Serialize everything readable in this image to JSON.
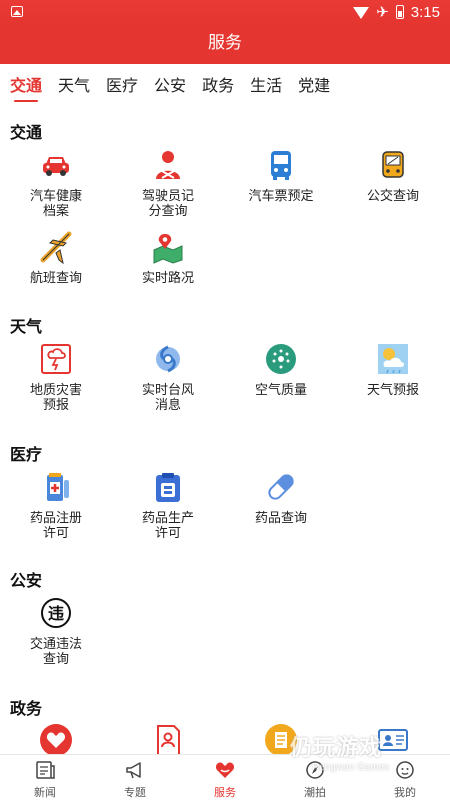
{
  "status": {
    "time": "3:15"
  },
  "header": {
    "title": "服务"
  },
  "tabs": [
    {
      "label": "交通"
    },
    {
      "label": "天气"
    },
    {
      "label": "医疗"
    },
    {
      "label": "公安"
    },
    {
      "label": "政务"
    },
    {
      "label": "生活"
    },
    {
      "label": "党建"
    }
  ],
  "sections": {
    "traffic": {
      "title": "交通",
      "items": [
        {
          "label": "汽车健康\n档案",
          "icon": "car-icon"
        },
        {
          "label": "驾驶员记\n分查询",
          "icon": "driver-icon"
        },
        {
          "label": "汽车票预定",
          "icon": "bus-icon"
        },
        {
          "label": "公交查询",
          "icon": "bus-card-icon"
        },
        {
          "label": "航班查询",
          "icon": "airplane-icon"
        },
        {
          "label": "实时路况",
          "icon": "map-pin-icon"
        }
      ]
    },
    "weather": {
      "title": "天气",
      "items": [
        {
          "label": "地质灾害\n预报",
          "icon": "disaster-icon"
        },
        {
          "label": "实时台风\n消息",
          "icon": "typhoon-icon"
        },
        {
          "label": "空气质量",
          "icon": "air-quality-icon"
        },
        {
          "label": "天气预报",
          "icon": "weather-icon"
        }
      ]
    },
    "medical": {
      "title": "医疗",
      "items": [
        {
          "label": "药品注册\n许可",
          "icon": "medicine-register-icon"
        },
        {
          "label": "药品生产\n许可",
          "icon": "medicine-production-icon"
        },
        {
          "label": "药品查询",
          "icon": "pill-icon"
        }
      ]
    },
    "police": {
      "title": "公安",
      "items": [
        {
          "label": "交通违法\n查询",
          "icon": "violation-icon"
        }
      ]
    },
    "government": {
      "title": "政务",
      "items": [
        {
          "label": "",
          "icon": "heart-icon"
        },
        {
          "label": "",
          "icon": "document-person-icon"
        },
        {
          "label": "",
          "icon": "certificate-icon"
        },
        {
          "label": "",
          "icon": "id-card-icon"
        }
      ]
    }
  },
  "bottom_nav": [
    {
      "label": "新闻",
      "icon": "news-icon"
    },
    {
      "label": "专题",
      "icon": "megaphone-icon"
    },
    {
      "label": "服务",
      "icon": "service-heart-icon"
    },
    {
      "label": "潮拍",
      "icon": "compass-icon"
    },
    {
      "label": "我的",
      "icon": "profile-icon"
    }
  ],
  "watermark": {
    "main": "仍玩游戏",
    "sub": "Rengwan Games"
  },
  "colors": {
    "accent": "#e53530"
  }
}
